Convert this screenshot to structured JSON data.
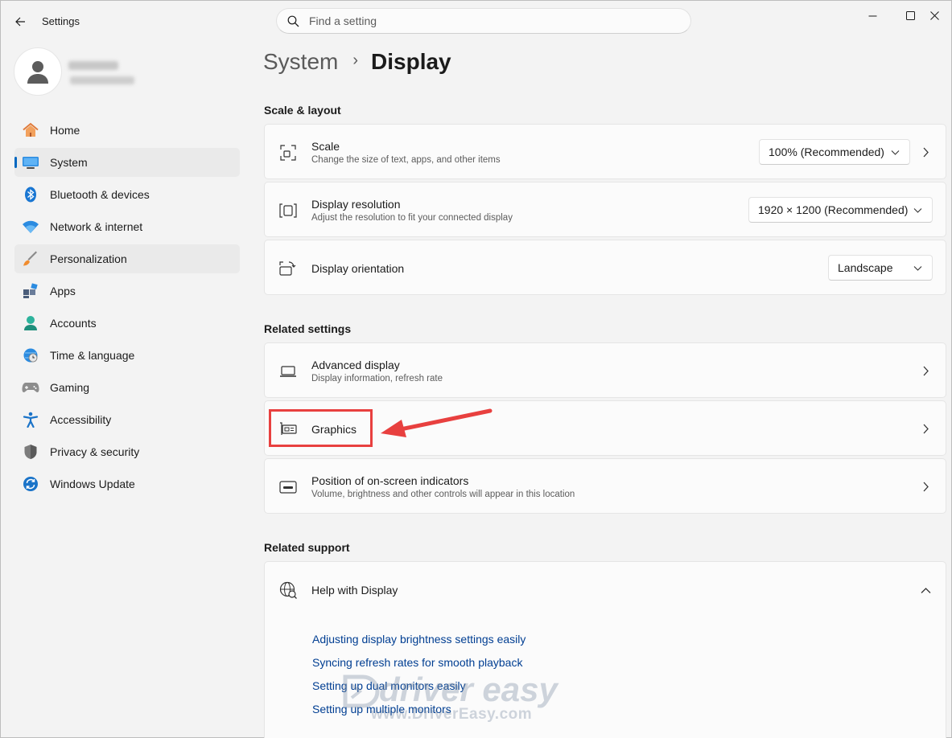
{
  "window": {
    "title": "Settings"
  },
  "search": {
    "placeholder": "Find a setting"
  },
  "sidebar": {
    "items": [
      {
        "label": "Home",
        "icon": "home-icon"
      },
      {
        "label": "System",
        "icon": "monitor-icon",
        "active": true
      },
      {
        "label": "Bluetooth & devices",
        "icon": "bluetooth-icon"
      },
      {
        "label": "Network & internet",
        "icon": "wifi-icon"
      },
      {
        "label": "Personalization",
        "icon": "brush-icon",
        "hover": true
      },
      {
        "label": "Apps",
        "icon": "apps-icon"
      },
      {
        "label": "Accounts",
        "icon": "person-icon"
      },
      {
        "label": "Time & language",
        "icon": "globe-clock-icon"
      },
      {
        "label": "Gaming",
        "icon": "gamepad-icon"
      },
      {
        "label": "Accessibility",
        "icon": "accessibility-icon"
      },
      {
        "label": "Privacy & security",
        "icon": "shield-icon"
      },
      {
        "label": "Windows Update",
        "icon": "update-icon"
      }
    ]
  },
  "breadcrumb": {
    "parent": "System",
    "separator": "›",
    "current": "Display"
  },
  "sections": {
    "scale_layout": "Scale & layout",
    "related_settings": "Related settings",
    "related_support": "Related support"
  },
  "cards": {
    "scale": {
      "title": "Scale",
      "subtitle": "Change the size of text, apps, and other items",
      "value": "100% (Recommended)"
    },
    "resolution": {
      "title": "Display resolution",
      "subtitle": "Adjust the resolution to fit your connected display",
      "value": "1920 × 1200 (Recommended)"
    },
    "orientation": {
      "title": "Display orientation",
      "value": "Landscape"
    },
    "advanced": {
      "title": "Advanced display",
      "subtitle": "Display information, refresh rate"
    },
    "graphics": {
      "title": "Graphics"
    },
    "indicators": {
      "title": "Position of on-screen indicators",
      "subtitle": "Volume, brightness and other controls will appear in this location"
    }
  },
  "help": {
    "title": "Help with Display",
    "links": [
      "Adjusting display brightness settings easily",
      "Syncing refresh rates for smooth playback",
      "Setting up dual monitors easily",
      "Setting up multiple monitors"
    ]
  },
  "watermark": {
    "brand": "driver easy",
    "url": "www.DriverEasy.com"
  },
  "colors": {
    "accent": "#0067c0",
    "link": "#003e92",
    "annotation": "#e8403f"
  }
}
